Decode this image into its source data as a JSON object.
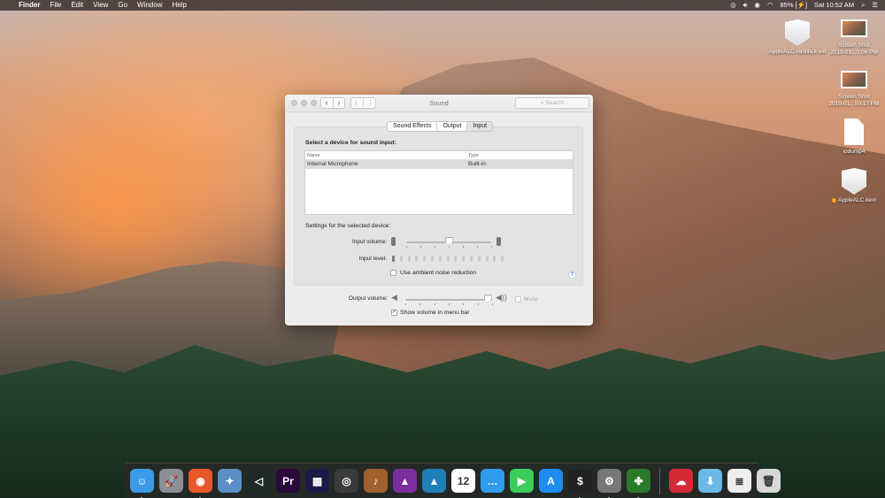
{
  "menubar": {
    "apple_icon": "apple-logo-icon",
    "app_name": "Finder",
    "menus": [
      "File",
      "Edit",
      "View",
      "Go",
      "Window",
      "Help"
    ],
    "status": {
      "battery_percent": "85%",
      "clock": "Sat 10:52 AM",
      "icons": [
        "creative-cloud-icon",
        "volume-icon",
        "nvidia-icon",
        "wifi-icon",
        "battery-charging-icon",
        "spotlight-search-icon",
        "notification-center-icon"
      ]
    }
  },
  "window": {
    "title": "Sound",
    "search_placeholder": "Search",
    "tabs": [
      {
        "label": "Sound Effects",
        "active": false
      },
      {
        "label": "Output",
        "active": false
      },
      {
        "label": "Input",
        "active": true
      }
    ],
    "input_section": {
      "heading": "Select a device for sound input:",
      "columns": [
        "Name",
        "Type"
      ],
      "rows": [
        {
          "name": "Internal Microphone",
          "type": "Built-in",
          "selected": true
        }
      ],
      "settings_heading": "Settings for the selected device:",
      "input_volume_label": "Input volume:",
      "input_volume_value": 0.5,
      "input_level_label": "Input level:",
      "input_level_segments": 15,
      "input_level_active": 1,
      "noise_reduction_label": "Use ambient noise reduction",
      "noise_reduction_checked": false,
      "help_label": "?"
    },
    "output_volume_label": "Output volume:",
    "output_volume_value": 0.95,
    "mute_label": "Mute",
    "mute_checked": false,
    "show_volume_label": "Show volume in menu bar",
    "show_volume_checked": true,
    "check_mark": "✓"
  },
  "desktop_icons": [
    {
      "label": "AppleALC.vanilla.kext",
      "display": "AppleALC.vanilla.k ext",
      "kind": "kext"
    },
    {
      "label_line1": "Screen Shot",
      "label_line2": "2019-01...0.06 PM",
      "kind": "screenshot"
    },
    {
      "label_line1": "Screen Shot",
      "label_line2": "2019-01...50.17 PM",
      "kind": "screenshot"
    },
    {
      "label": "iodump4",
      "kind": "document"
    },
    {
      "label": "AppleALC.kext",
      "kind": "kext",
      "tag_color": "#f5a623"
    }
  ],
  "dock": {
    "apps": [
      {
        "name": "Finder",
        "glyph": "☺",
        "color": "#3d9ae8",
        "running": true
      },
      {
        "name": "Launchpad",
        "glyph": "🚀",
        "color": "#8a8f96",
        "running": false
      },
      {
        "name": "Firefox",
        "glyph": "◉",
        "color": "#e8582a",
        "running": true
      },
      {
        "name": "Preview",
        "glyph": "✦",
        "color": "#5b8fc7",
        "running": false
      },
      {
        "name": "Visual Studio Code",
        "glyph": "◁",
        "color": "#1f2a24",
        "running": false
      },
      {
        "name": "Adobe Premiere Pro",
        "glyph": "Pr",
        "color": "#2a0a3a",
        "running": false
      },
      {
        "name": "Adobe Media Encoder",
        "glyph": "▦",
        "color": "#1d1a4a",
        "running": false
      },
      {
        "name": "Logic Pro",
        "glyph": "◎",
        "color": "#3a3a3a",
        "running": false
      },
      {
        "name": "GarageBand",
        "glyph": "♪",
        "color": "#a0612e",
        "running": false
      },
      {
        "name": "Affinity Photo",
        "glyph": "▲",
        "color": "#7b2f9e",
        "running": false
      },
      {
        "name": "Affinity Designer",
        "glyph": "▲",
        "color": "#1f7fb7",
        "running": false
      },
      {
        "name": "Calendar",
        "glyph": "12",
        "color": "#ffffff",
        "running": false
      },
      {
        "name": "Messages",
        "glyph": "…",
        "color": "#2f9cf0",
        "running": false
      },
      {
        "name": "FaceTime",
        "glyph": "▶",
        "color": "#3dcc5a",
        "running": false
      },
      {
        "name": "App Store",
        "glyph": "A",
        "color": "#1e8cf0",
        "running": false
      },
      {
        "name": "Terminal",
        "glyph": "$",
        "color": "#222",
        "running": true
      },
      {
        "name": "System Preferences",
        "glyph": "⚙",
        "color": "#777",
        "running": true
      },
      {
        "name": "Clover Configurator",
        "glyph": "✤",
        "color": "#2a7a2a",
        "running": true
      }
    ],
    "stacks": [
      {
        "name": "Creative Cloud Files",
        "glyph": "☁",
        "color": "#d42a36"
      },
      {
        "name": "Downloads",
        "glyph": "⬇",
        "color": "#6ab8e8"
      },
      {
        "name": "Document",
        "glyph": "≣",
        "color": "#eeeeee"
      },
      {
        "name": "Trash",
        "glyph": "🗑",
        "color": "#d8d8d8"
      }
    ]
  }
}
